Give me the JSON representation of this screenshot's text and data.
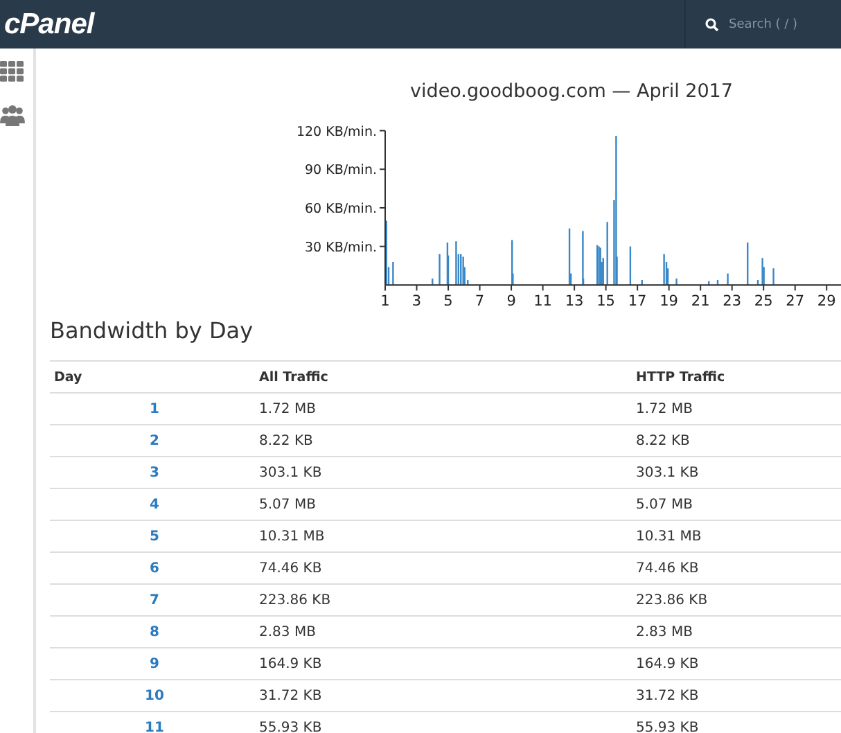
{
  "header": {
    "logo": "cPanel",
    "search": {
      "placeholder": "Search ( / )"
    }
  },
  "chart": {
    "title": "video.goodboog.com — April 2017",
    "chart_data": {
      "type": "bar",
      "x": [
        1.08,
        1.22,
        1.5,
        4.0,
        4.45,
        4.95,
        5.0,
        5.5,
        5.65,
        5.8,
        5.95,
        6.04,
        6.24,
        9.05,
        9.1,
        12.69,
        12.78,
        13.54,
        13.57,
        14.45,
        14.56,
        14.65,
        14.74,
        14.83,
        15.09,
        15.52,
        15.65,
        15.7,
        16.55,
        17.29,
        18.69,
        18.84,
        18.93,
        19.48,
        21.53,
        22.09,
        22.73,
        23.99,
        24.64,
        24.93,
        25.02,
        25.63
      ],
      "series": [
        {
          "color": "#3a87c8",
          "values": [
            50,
            14,
            18,
            5,
            24,
            33,
            23,
            34,
            24,
            24,
            22,
            14,
            4,
            35,
            9,
            44,
            9,
            42,
            5,
            31,
            30,
            29,
            18,
            21,
            49,
            66,
            116,
            22,
            30,
            4,
            24,
            18,
            13,
            5,
            3,
            4,
            9,
            33,
            4,
            21,
            14,
            13
          ]
        }
      ],
      "xlim": [
        1,
        30
      ],
      "ylim": [
        0,
        120
      ],
      "xticks": [
        1,
        3,
        5,
        7,
        9,
        11,
        13,
        15,
        17,
        19,
        21,
        23,
        25,
        27,
        29
      ],
      "yticks": [
        {
          "value": 30,
          "label": "30 KB/min."
        },
        {
          "value": 60,
          "label": "60 KB/min."
        },
        {
          "value": 90,
          "label": "90 KB/min."
        },
        {
          "value": 120,
          "label": "120 KB/min."
        }
      ]
    }
  },
  "bandwidth": {
    "heading": "Bandwidth by Day",
    "columns": [
      "Day",
      "All Traffic",
      "HTTP Traffic"
    ],
    "rows": [
      {
        "day": "1",
        "all": "1.72 MB",
        "http": "1.72 MB"
      },
      {
        "day": "2",
        "all": "8.22 KB",
        "http": "8.22 KB"
      },
      {
        "day": "3",
        "all": "303.1 KB",
        "http": "303.1 KB"
      },
      {
        "day": "4",
        "all": "5.07 MB",
        "http": "5.07 MB"
      },
      {
        "day": "5",
        "all": "10.31 MB",
        "http": "10.31 MB"
      },
      {
        "day": "6",
        "all": "74.46 KB",
        "http": "74.46 KB"
      },
      {
        "day": "7",
        "all": "223.86 KB",
        "http": "223.86 KB"
      },
      {
        "day": "8",
        "all": "2.83 MB",
        "http": "2.83 MB"
      },
      {
        "day": "9",
        "all": "164.9 KB",
        "http": "164.9 KB"
      },
      {
        "day": "10",
        "all": "31.72 KB",
        "http": "31.72 KB"
      },
      {
        "day": "11",
        "all": "55.93 KB",
        "http": "55.93 KB"
      }
    ]
  }
}
